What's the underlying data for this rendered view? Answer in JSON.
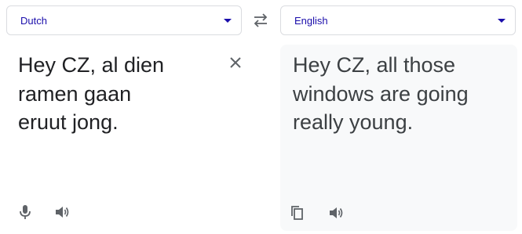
{
  "source": {
    "language": "Dutch",
    "text": "Hey CZ, al dien\nramen gaan\neruut jong."
  },
  "target": {
    "language": "English",
    "text": "Hey CZ, all those\nwindows are going\nreally young."
  },
  "icons": {
    "swap": "swap-languages-icon",
    "clear": "close-icon",
    "mic": "microphone-icon",
    "speaker": "speaker-icon",
    "copy": "copy-icon"
  },
  "colors": {
    "language_label": "#1a0dab",
    "target_background": "#f8f9fa",
    "icon_gray": "#5f6368"
  }
}
